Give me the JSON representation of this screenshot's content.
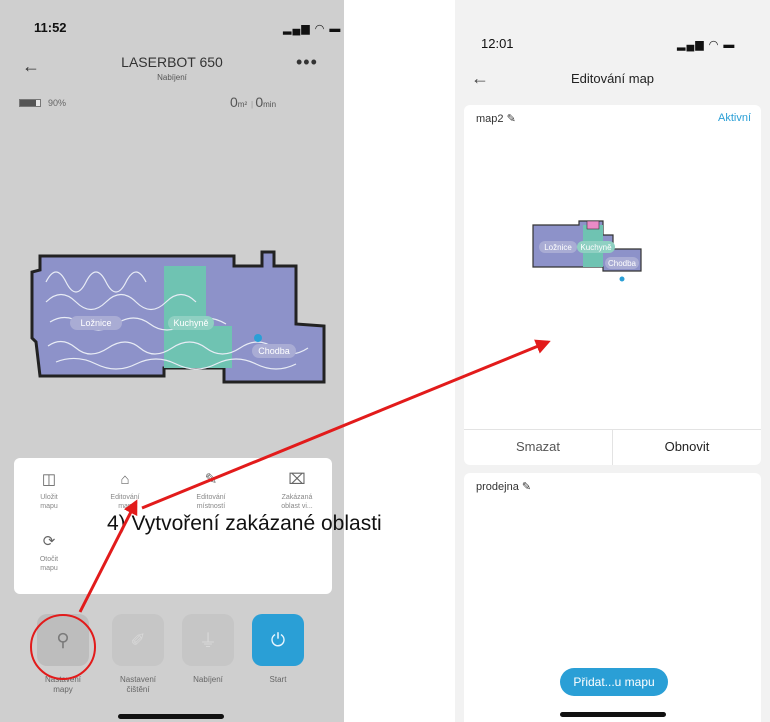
{
  "left_phone": {
    "status_time": "11:52",
    "status_icons": "▂▄▆ ◠ ▬",
    "device_name": "LASERBOT 650",
    "device_status": "Nabíjení",
    "battery_percent": "90%",
    "area_value": "0",
    "area_unit": "m²",
    "time_value": "0",
    "time_unit": "min",
    "rooms": [
      "Ložnice",
      "Kuchyně",
      "Chodba"
    ],
    "panel_items": [
      {
        "label_1": "Uložit",
        "label_2": "mapu",
        "icon": "save-icon"
      },
      {
        "label_1": "Editování",
        "label_2": "map",
        "icon": "edit-map-icon"
      },
      {
        "label_1": "Editování",
        "label_2": "místností",
        "icon": "edit-rooms-icon"
      },
      {
        "label_1": "Zakázaná",
        "label_2": "oblast vi...",
        "icon": "forbidden-zone-icon"
      },
      {
        "label_1": "Otočit",
        "label_2": "mapu",
        "icon": "rotate-icon"
      }
    ],
    "bottom_buttons": [
      {
        "label_1": "Nastavení",
        "label_2": "mapy",
        "icon": "map-settings-icon"
      },
      {
        "label_1": "Nastavení",
        "label_2": "čištění",
        "icon": "brush-icon"
      },
      {
        "label_1": "Nabíjení",
        "label_2": "",
        "icon": "plug-icon"
      },
      {
        "label_1": "Start",
        "label_2": "",
        "icon": "power-icon"
      }
    ]
  },
  "right_phone": {
    "status_time": "12:01",
    "status_icons": "▂▄▆ ◠ ▬",
    "title": "Editování map",
    "map_card": {
      "name": "map2",
      "status": "Aktivní",
      "rooms": [
        "Ložnice",
        "Kuchyně",
        "Chodba"
      ],
      "delete_label": "Smazat",
      "restore_label": "Obnovit"
    },
    "second_card": {
      "name": "prodejna",
      "add_button": "Přidat...u mapu"
    }
  },
  "annotation": {
    "text": "4)  Vytvoření zakázané oblasti",
    "color": "#e21b1b"
  },
  "colors": {
    "accent": "#2a9fd6",
    "room_blue": "#8d92c9",
    "room_teal": "#6fc3b2",
    "room_pink": "#e98bc6"
  }
}
